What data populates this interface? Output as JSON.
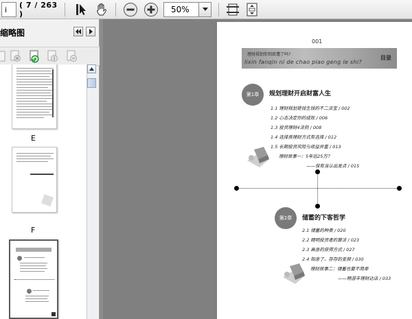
{
  "toolbar": {
    "page_input": "i",
    "page_count": "( 7 / 263 )",
    "zoom_value": "50%"
  },
  "sidebar": {
    "title": "缩略图",
    "thumb_labels": [
      "E",
      "F"
    ]
  },
  "document": {
    "page_number": "001",
    "banner_line1": "理财规划你到底懂了吗?",
    "banner_pinyin": "lixin fanqin ni de chao piao geng le shi?",
    "banner_badge": "目录",
    "chapter1": {
      "badge": "第1章",
      "title": "规划理财开启财富人生",
      "items": [
        "1.1  理财规划是钱生钱的不二法宝 / 002",
        "1.2  心态决定你的成败 / 006",
        "1.3  投资理财4法则 / 008",
        "1.4  选择良理财方式有选择 / 012",
        "1.5  长期投资风险与收益并重 / 013"
      ],
      "story": "理财故事一：5年后25万？",
      "story_sub": "——保有当认出发点 / 015"
    },
    "chapter2": {
      "badge": "第2章",
      "title": "储蓄的下客哲学",
      "items": [
        "2.1  储蓄的种类 / 020",
        "2.2  精明投资者的算法 / 023",
        "2.3  高息的获得方式 / 027",
        "2.4  阳息了，存存的变频 / 030"
      ],
      "story": "理财故事二：储蓄也要不简单",
      "story_sub": "——畅游丰理财达店 / 033"
    }
  }
}
